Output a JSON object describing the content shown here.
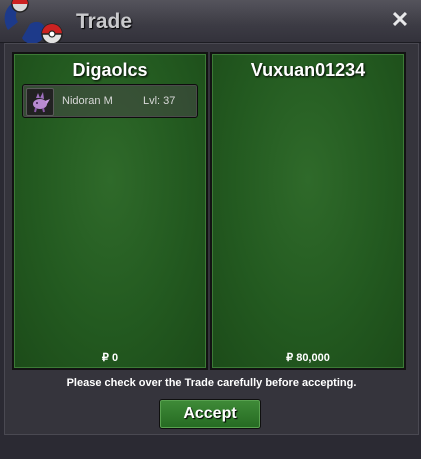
{
  "window": {
    "title": "Trade",
    "close_symbol": "✕"
  },
  "trade": {
    "left": {
      "player_name": "Digaolcs",
      "items": [
        {
          "icon": "nidoran-m-icon",
          "name": "Nidoran M",
          "level": "Lvl: 37"
        }
      ],
      "money": "₽ 0"
    },
    "right": {
      "player_name": "Vuxuan01234",
      "items": [],
      "money": "₽ 80,000"
    }
  },
  "notice": "Please check over the Trade carefully before accepting.",
  "accept_label": "Accept",
  "colors": {
    "panel_green": "#235a20",
    "button_green": "#2f7a2a",
    "title_text": "#c9c9cc"
  }
}
